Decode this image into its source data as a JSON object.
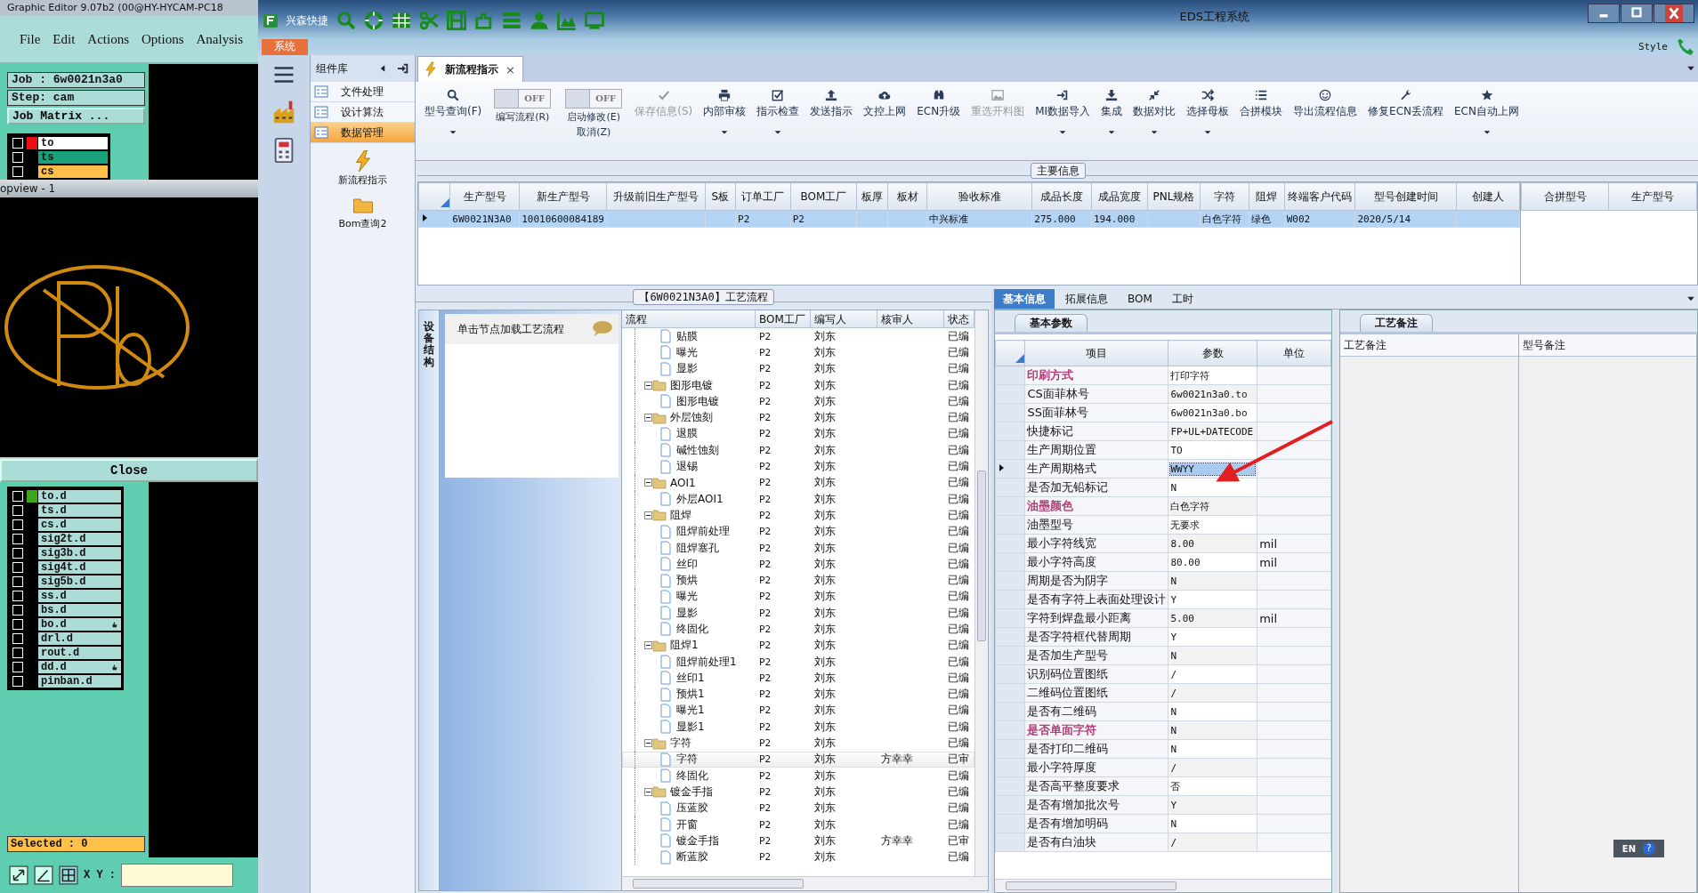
{
  "genesis": {
    "title": "Graphic Editor 9.07b2 (00@HY-HYCAM-PC18",
    "menu": [
      "File",
      "Edit",
      "Actions",
      "Options",
      "Analysis"
    ],
    "job": "Job : 6w0021n3a0",
    "step": "Step: cam",
    "matrix_button": "Job Matrix ...",
    "layers_top": [
      {
        "name": "to",
        "color": "#ffffff",
        "active": true,
        "checked": false
      },
      {
        "name": "ts",
        "color": "#19a07c",
        "active": false,
        "checked": false
      },
      {
        "name": "cs",
        "color": "#ffc04a",
        "active": false,
        "checked": false
      }
    ],
    "popup": {
      "title": "opview - 1",
      "close": "Close"
    },
    "layers": [
      {
        "name": "to.d",
        "active": true,
        "pinned": false,
        "checked": false
      },
      {
        "name": "ts.d",
        "active": false,
        "pinned": false,
        "checked": false
      },
      {
        "name": "cs.d",
        "active": false,
        "pinned": false,
        "checked": false
      },
      {
        "name": "sig2t.d",
        "active": false,
        "pinned": false,
        "checked": false
      },
      {
        "name": "sig3b.d",
        "active": false,
        "pinned": false,
        "checked": false
      },
      {
        "name": "sig4t.d",
        "active": false,
        "pinned": false,
        "checked": false
      },
      {
        "name": "sig5b.d",
        "active": false,
        "pinned": false,
        "checked": false
      },
      {
        "name": "ss.d",
        "active": false,
        "pinned": false,
        "checked": false
      },
      {
        "name": "bs.d",
        "active": false,
        "pinned": false,
        "checked": false
      },
      {
        "name": "bo.d",
        "active": false,
        "pinned": true,
        "checked": false
      },
      {
        "name": "drl.d",
        "active": false,
        "pinned": false,
        "checked": false
      },
      {
        "name": "rout.d",
        "active": false,
        "pinned": false,
        "checked": false
      },
      {
        "name": "dd.d",
        "active": false,
        "pinned": true,
        "checked": false
      },
      {
        "name": "pinban.d",
        "active": false,
        "pinned": false,
        "checked": false
      }
    ],
    "selected": "Selected : 0",
    "xy_label": "X Y :"
  },
  "window": {
    "title": "EDS工程系统",
    "quick_label": "兴森快捷",
    "app_tab": "系统",
    "style": "Style"
  },
  "sidebar": {
    "title": "组件库",
    "items": [
      {
        "label": "文件处理",
        "selected": false
      },
      {
        "label": "设计算法",
        "selected": false
      },
      {
        "label": "数据管理",
        "selected": true
      }
    ],
    "tools": [
      "新流程指示",
      "Bom查询2"
    ]
  },
  "document_tab": {
    "label": "新流程指示",
    "close": "×"
  },
  "toolbar": [
    {
      "kind": "button",
      "label": "型号查询(F)",
      "dropdown": true,
      "disabled": false
    },
    {
      "kind": "toggle",
      "label": "编写流程(R)",
      "on": false,
      "state_text": "OFF"
    },
    {
      "kind": "toggle",
      "label": "启动修改(E)",
      "label2": "取消(Z)",
      "on": false,
      "state_text": "OFF"
    },
    {
      "kind": "button",
      "label": "保存信息(S)",
      "dropdown": false,
      "disabled": true
    },
    {
      "kind": "button",
      "label": "内部审核",
      "dropdown": true,
      "disabled": false
    },
    {
      "kind": "button",
      "label": "指示检查",
      "dropdown": true,
      "disabled": false
    },
    {
      "kind": "button",
      "label": "发送指示",
      "dropdown": false,
      "disabled": false
    },
    {
      "kind": "button",
      "label": "文控上网",
      "dropdown": false,
      "disabled": false
    },
    {
      "kind": "button",
      "label": "ECN升级",
      "dropdown": false,
      "disabled": false
    },
    {
      "kind": "button",
      "label": "重选开料图",
      "dropdown": false,
      "disabled": true
    },
    {
      "kind": "button",
      "label": "MI数据导入",
      "dropdown": true,
      "disabled": false
    },
    {
      "kind": "button",
      "label": "集成",
      "dropdown": true,
      "disabled": false
    },
    {
      "kind": "button",
      "label": "数据对比",
      "dropdown": true,
      "disabled": false
    },
    {
      "kind": "button",
      "label": "选择母板",
      "dropdown": true,
      "disabled": false
    },
    {
      "kind": "button",
      "label": "合拼模块",
      "dropdown": false,
      "disabled": false
    },
    {
      "kind": "button",
      "label": "导出流程信息",
      "dropdown": false,
      "disabled": false
    },
    {
      "kind": "button",
      "label": "修复ECN丢流程",
      "dropdown": false,
      "disabled": false
    },
    {
      "kind": "button",
      "label": "ECN自动上网",
      "dropdown": true,
      "disabled": false
    }
  ],
  "main_info": {
    "title": "主要信息",
    "columns": [
      "生产型号",
      "新生产型号",
      "升级前旧生产型号",
      "S板",
      "订单工厂",
      "BOM工厂",
      "板厚",
      "板材",
      "验收标准",
      "成品长度",
      "成品宽度",
      "PNL规格",
      "字符",
      "阻焊",
      "终端客户代码",
      "型号创建时间",
      "创建人"
    ],
    "rows": [
      {
        "selected": true,
        "cells": [
          "6W0021N3A0",
          "10010600084189",
          null,
          null,
          "P2",
          "P2",
          null,
          null,
          "中兴标准",
          "275.000",
          "194.000",
          null,
          "白色字符",
          "绿色",
          "W002",
          "2020/5/14",
          null
        ]
      }
    ],
    "side_columns": [
      "合拼型号",
      "生产型号"
    ]
  },
  "process": {
    "title": "【6W0021N3A0】工艺流程",
    "side_tab": "设备结构",
    "hint": "单击节点加载工艺流程",
    "columns": [
      "流程",
      "BOM工厂",
      "编写人",
      "核审人",
      "状态"
    ],
    "nodes": [
      {
        "children": [
          {
            "name": "贴膜",
            "bom": "P2",
            "writer": "刘东",
            "status": "已编",
            "selected": false
          },
          {
            "name": "曝光",
            "bom": "P2",
            "writer": "刘东",
            "status": "已编",
            "selected": false
          },
          {
            "name": "显影",
            "bom": "P2",
            "writer": "刘东",
            "status": "已编",
            "selected": false
          }
        ]
      },
      {
        "name": "图形电镀",
        "bom": "P2",
        "writer": "刘东",
        "status": "已编",
        "selected": false,
        "expanded": true,
        "children": [
          {
            "name": "图形电镀",
            "bom": "P2",
            "writer": "刘东",
            "status": "已编",
            "selected": false
          }
        ]
      },
      {
        "name": "外层蚀刻",
        "bom": "P2",
        "writer": "刘东",
        "status": "已编",
        "selected": false,
        "expanded": true,
        "children": [
          {
            "name": "退膜",
            "bom": "P2",
            "writer": "刘东",
            "status": "已编",
            "selected": false
          },
          {
            "name": "碱性蚀刻",
            "bom": "P2",
            "writer": "刘东",
            "status": "已编",
            "selected": false
          },
          {
            "name": "退锡",
            "bom": "P2",
            "writer": "刘东",
            "status": "已编",
            "selected": false
          }
        ]
      },
      {
        "name": "AOI1",
        "bom": "P2",
        "writer": "刘东",
        "status": "已编",
        "selected": false,
        "expanded": true,
        "children": [
          {
            "name": "外层AOI1",
            "bom": "P2",
            "writer": "刘东",
            "status": "已编",
            "selected": false
          }
        ]
      },
      {
        "name": "阻焊",
        "bom": "P2",
        "writer": "刘东",
        "status": "已编",
        "selected": false,
        "expanded": true,
        "children": [
          {
            "name": "阻焊前处理",
            "bom": "P2",
            "writer": "刘东",
            "status": "已编",
            "selected": false
          },
          {
            "name": "阻焊塞孔",
            "bom": "P2",
            "writer": "刘东",
            "status": "已编",
            "selected": false
          },
          {
            "name": "丝印",
            "bom": "P2",
            "writer": "刘东",
            "status": "已编",
            "selected": false
          },
          {
            "name": "预烘",
            "bom": "P2",
            "writer": "刘东",
            "status": "已编",
            "selected": false
          },
          {
            "name": "曝光",
            "bom": "P2",
            "writer": "刘东",
            "status": "已编",
            "selected": false
          },
          {
            "name": "显影",
            "bom": "P2",
            "writer": "刘东",
            "status": "已编",
            "selected": false
          },
          {
            "name": "终固化",
            "bom": "P2",
            "writer": "刘东",
            "status": "已编",
            "selected": false
          }
        ]
      },
      {
        "name": "阻焊1",
        "bom": "P2",
        "writer": "刘东",
        "status": "已编",
        "selected": false,
        "expanded": true,
        "children": [
          {
            "name": "阻焊前处理1",
            "bom": "P2",
            "writer": "刘东",
            "status": "已编",
            "selected": false
          },
          {
            "name": "丝印1",
            "bom": "P2",
            "writer": "刘东",
            "status": "已编",
            "selected": false
          },
          {
            "name": "预烘1",
            "bom": "P2",
            "writer": "刘东",
            "status": "已编",
            "selected": false
          },
          {
            "name": "曝光1",
            "bom": "P2",
            "writer": "刘东",
            "status": "已编",
            "selected": false
          },
          {
            "name": "显影1",
            "bom": "P2",
            "writer": "刘东",
            "status": "已编",
            "selected": false
          }
        ]
      },
      {
        "name": "字符",
        "bom": "P2",
        "writer": "刘东",
        "status": "已编",
        "selected": false,
        "expanded": true,
        "children": [
          {
            "name": "字符",
            "bom": "P2",
            "writer": "刘东",
            "reviewer": "方幸幸",
            "status": "已审",
            "selected": true
          },
          {
            "name": "终固化",
            "bom": "P2",
            "writer": "刘东",
            "status": "已编",
            "selected": false
          }
        ]
      },
      {
        "name": "镀金手指",
        "bom": "P2",
        "writer": "刘东",
        "status": "已编",
        "selected": false,
        "expanded": true,
        "children": [
          {
            "name": "压蓝胶",
            "bom": "P2",
            "writer": "刘东",
            "status": "已编",
            "selected": false
          },
          {
            "name": "开窗",
            "bom": "P2",
            "writer": "刘东",
            "status": "已编",
            "selected": false
          },
          {
            "name": "镀金手指",
            "bom": "P2",
            "writer": "刘东",
            "reviewer": "方幸幸",
            "status": "已审",
            "selected": false
          },
          {
            "name": "断蓝胶",
            "bom": "P2",
            "writer": "刘东",
            "status": "已编",
            "selected": false
          }
        ]
      }
    ]
  },
  "detail_tabs": [
    {
      "label": "基本信息",
      "selected": true
    },
    {
      "label": "拓展信息",
      "selected": false
    },
    {
      "label": "BOM",
      "selected": false
    },
    {
      "label": "工时",
      "selected": false
    }
  ],
  "params": {
    "title": "基本参数",
    "columns": [
      "项目",
      "参数",
      "单位"
    ],
    "rows": [
      {
        "item": "印刷方式",
        "value": "打印字符",
        "color": "#b0306e",
        "selected": false
      },
      {
        "item": "CS面菲林号",
        "value": "6w0021n3a0.to",
        "selected": false
      },
      {
        "item": "SS面菲林号",
        "value": "6w0021n3a0.bo",
        "selected": false
      },
      {
        "item": "快捷标记",
        "value": "FP+UL+DATECODE",
        "selected": false
      },
      {
        "item": "生产周期位置",
        "value": "TO",
        "selected": false
      },
      {
        "item": "生产周期格式",
        "value": "WWYY",
        "selected": true
      },
      {
        "item": "是否加无铅标记",
        "value": "N",
        "selected": false
      },
      {
        "item": "油墨颜色",
        "value": "白色字符",
        "color": "#b0306e",
        "selected": false
      },
      {
        "item": "油墨型号",
        "value": "无要求",
        "selected": false
      },
      {
        "item": "最小字符线宽",
        "value": "8.00",
        "unit": "mil",
        "selected": false
      },
      {
        "item": "最小字符高度",
        "value": "80.00",
        "unit": "mil",
        "selected": false
      },
      {
        "item": "周期是否为阴字",
        "value": "N",
        "selected": false
      },
      {
        "item": "是否有字符上表面处理设计",
        "value": "Y",
        "selected": false
      },
      {
        "item": "字符到焊盘最小距离",
        "value": "5.00",
        "unit": "mil",
        "selected": false
      },
      {
        "item": "是否字符框代替周期",
        "value": "Y",
        "selected": false
      },
      {
        "item": "是否加生产型号",
        "value": "N",
        "selected": false
      },
      {
        "item": "识别码位置图纸",
        "value": "/",
        "selected": false
      },
      {
        "item": "二维码位置图纸",
        "value": "/",
        "selected": false
      },
      {
        "item": "是否有二维码",
        "value": "N",
        "selected": false
      },
      {
        "item": "是否单面字符",
        "value": "N",
        "color": "#b0306e",
        "selected": false
      },
      {
        "item": "是否打印二维码",
        "value": "N",
        "selected": false
      },
      {
        "item": "最小字符厚度",
        "value": "/",
        "selected": false
      },
      {
        "item": "是否高平整度要求",
        "value": "否",
        "selected": false
      },
      {
        "item": "是否有增加批次号",
        "value": "Y",
        "selected": false
      },
      {
        "item": "是否有增加明码",
        "value": "N",
        "selected": false
      },
      {
        "item": "是否有白油块",
        "value": "/",
        "selected": false
      }
    ]
  },
  "remarks": {
    "title": "工艺备注",
    "columns": [
      "工艺备注",
      "型号备注"
    ]
  },
  "ime": {
    "label": "EN",
    "help": "?"
  }
}
